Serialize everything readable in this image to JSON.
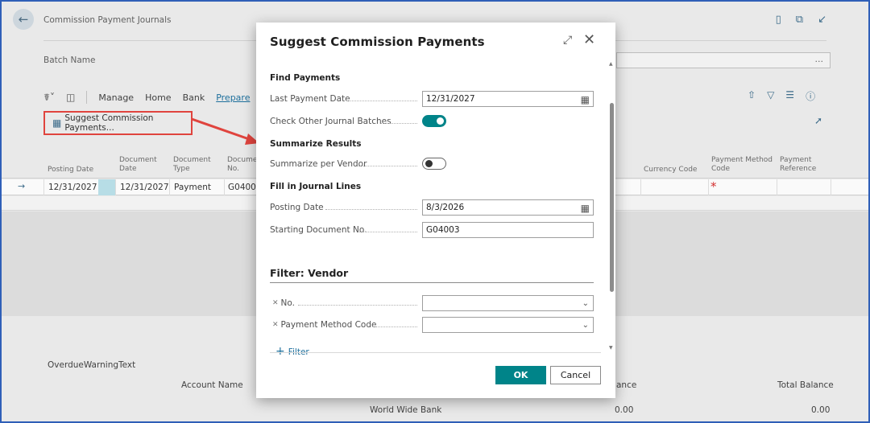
{
  "page": {
    "title": "Commission Payment Journals",
    "batch_name_label": "Batch Name",
    "batch_name_value": "...",
    "actions": [
      "Manage",
      "Home",
      "Bank",
      "Prepare"
    ],
    "suggest_button": "Suggest Commission Payments...",
    "columns": [
      "Posting Date",
      "Document Date",
      "Document Type",
      "Document No.",
      "Currency Code",
      "Payment Method Code",
      "Payment Reference"
    ],
    "row": {
      "posting_date": "12/31/2027",
      "document_date": "12/31/2027",
      "document_type": "Payment",
      "document_no": "G04003",
      "required_marker": "*"
    },
    "overdue_warning": "OverdueWarningText",
    "account_name_label": "Account Name",
    "balance_label_partial": "ance",
    "total_balance_label": "Total Balance",
    "account_name": "World Wide Bank",
    "balance": "0.00",
    "total_balance": "0.00"
  },
  "dialog": {
    "title": "Suggest Commission Payments",
    "section_find": "Find Payments",
    "last_payment_date_label": "Last Payment Date",
    "last_payment_date": "12/31/2027",
    "check_other_label": "Check Other Journal Batches",
    "check_other_on": true,
    "section_summarize": "Summarize Results",
    "summarize_vendor_label": "Summarize per Vendor",
    "summarize_vendor_on": false,
    "section_fill": "Fill in Journal Lines",
    "posting_date_label": "Posting Date",
    "posting_date": "8/3/2026",
    "starting_doc_label": "Starting Document No.",
    "starting_doc": "G04003",
    "filter_heading": "Filter: Vendor",
    "filter_no_label": "No.",
    "filter_no_value": "",
    "filter_pmc_label": "Payment Method Code",
    "filter_pmc_value": "",
    "add_filter": "Filter",
    "ok_label": "OK",
    "cancel_label": "Cancel"
  },
  "colors": {
    "accent": "#008489",
    "callout": "#e0443e",
    "link": "#1d6f9c"
  }
}
